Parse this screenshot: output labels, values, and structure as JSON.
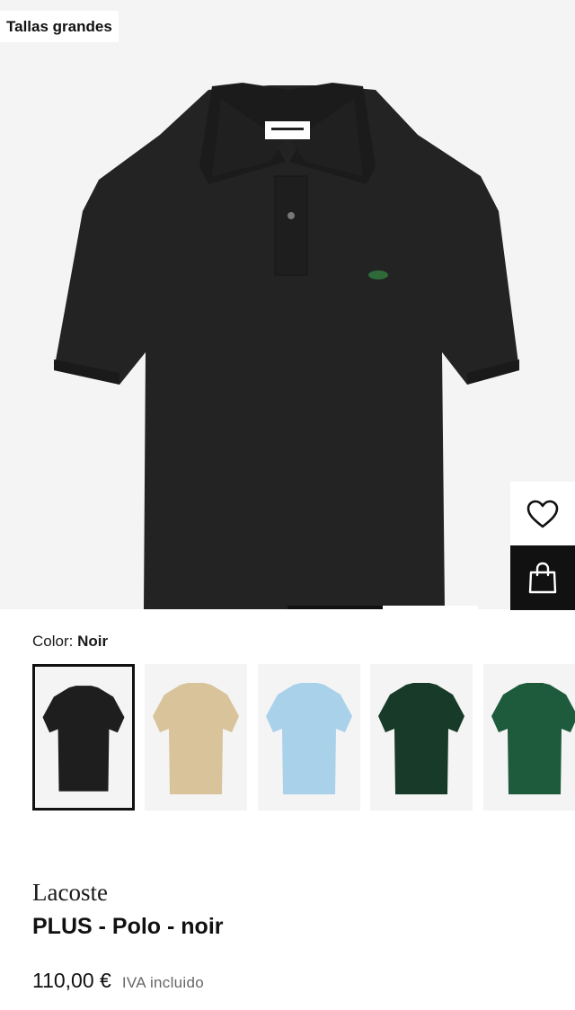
{
  "badge": {
    "label": "Tallas grandes"
  },
  "hero": {
    "image_alt": "PLUS - Polo - noir",
    "shirt_color": "#232323"
  },
  "actions": {
    "wishlist_icon": "heart-icon",
    "bag_icon": "shopping-bag-icon"
  },
  "gallery": {
    "active_index": 1,
    "total": 2
  },
  "color": {
    "label": "Color:",
    "selected": "Noir",
    "swatches": [
      {
        "name": "black",
        "color": "#1e1e1e"
      },
      {
        "name": "beige",
        "color": "#d8c39b"
      },
      {
        "name": "light-blue",
        "color": "#a9d1ea"
      },
      {
        "name": "dark-green",
        "color": "#183a29"
      },
      {
        "name": "green",
        "color": "#1e5a3c"
      }
    ]
  },
  "product": {
    "brand": "Lacoste",
    "name": "PLUS - Polo - noir",
    "price": "110,00 €",
    "tax_note": "IVA incluido"
  }
}
